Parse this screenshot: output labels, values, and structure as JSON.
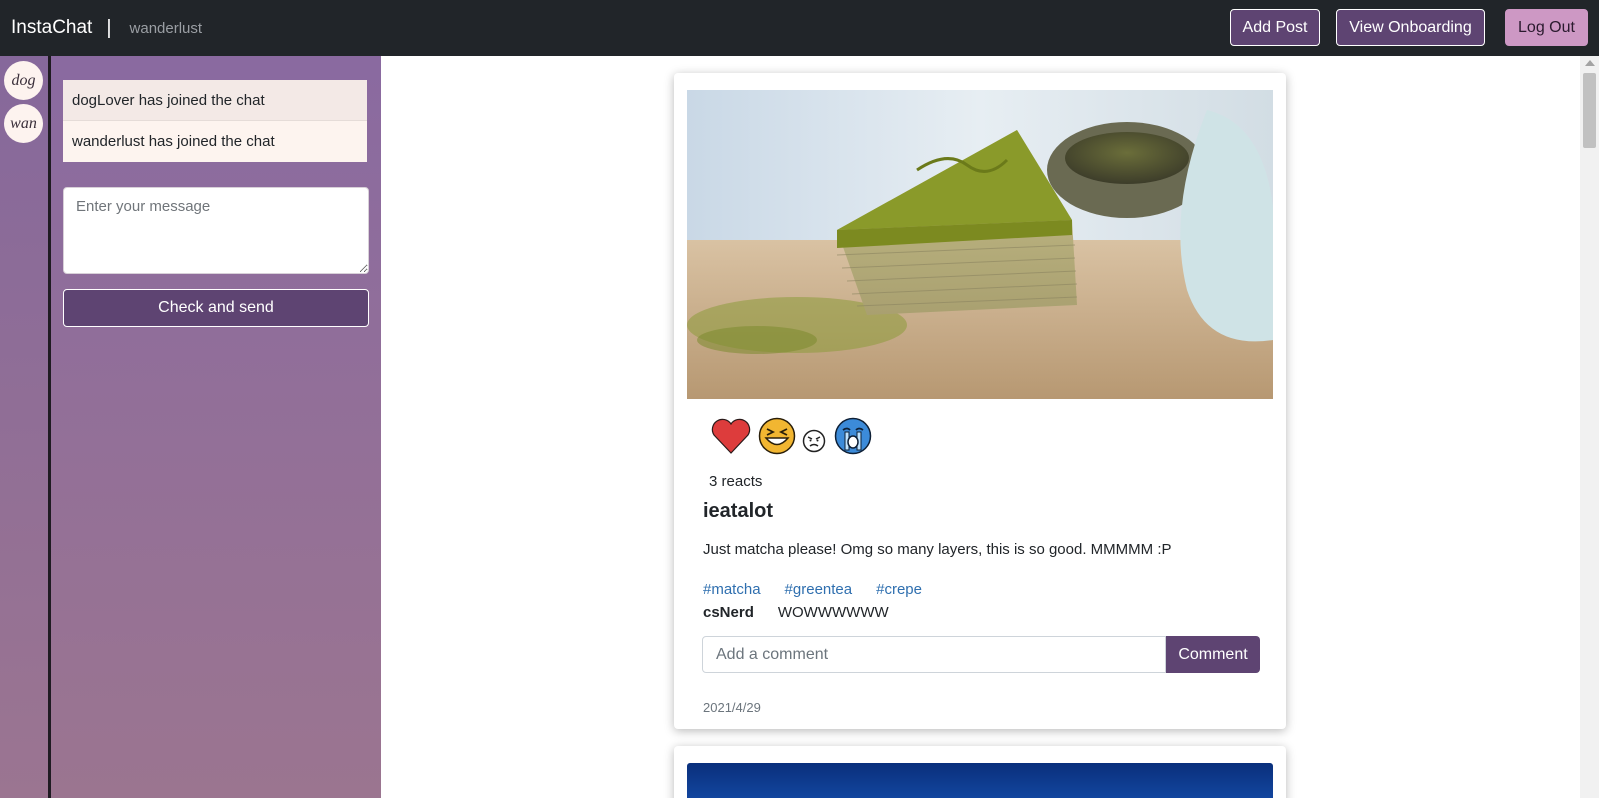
{
  "navbar": {
    "brand": "InstaChat",
    "separator": "|",
    "username": "wanderlust",
    "add_post": "Add Post",
    "view_onboarding": "View Onboarding",
    "log_out": "Log Out"
  },
  "users": [
    {
      "short": "dog"
    },
    {
      "short": "wan"
    }
  ],
  "chat": {
    "messages": [
      {
        "text": "dogLover has joined the chat"
      },
      {
        "text": "wanderlust has joined the chat"
      }
    ],
    "input_placeholder": "Enter your message",
    "input_value": "",
    "send_label": "Check and send"
  },
  "post": {
    "image_icon": "matcha-crepe-cake-photo",
    "reactions": [
      {
        "icon": "heart-icon",
        "color": "#dd3c3c"
      },
      {
        "icon": "laughing-face-icon",
        "color": "#f2b631"
      },
      {
        "icon": "angry-face-icon",
        "color": "#222222"
      },
      {
        "icon": "crying-face-icon",
        "color": "#3c8bd9"
      }
    ],
    "react_count": "3 reacts",
    "username": "ieatalot",
    "caption": "Just matcha please! Omg so many layers, this is so good. MMMMM :P",
    "tags": [
      "#matcha",
      "#greentea",
      "#crepe"
    ],
    "comments": [
      {
        "user": "csNerd",
        "text": "WOWWWWWW"
      }
    ],
    "comment_placeholder": "Add a comment",
    "comment_value": "",
    "comment_button": "Comment",
    "date": "2021/4/29"
  },
  "colors": {
    "navbar": "#212529",
    "accent": "#5e4472",
    "logout": "#cd98c4",
    "link": "#2f6faf"
  }
}
